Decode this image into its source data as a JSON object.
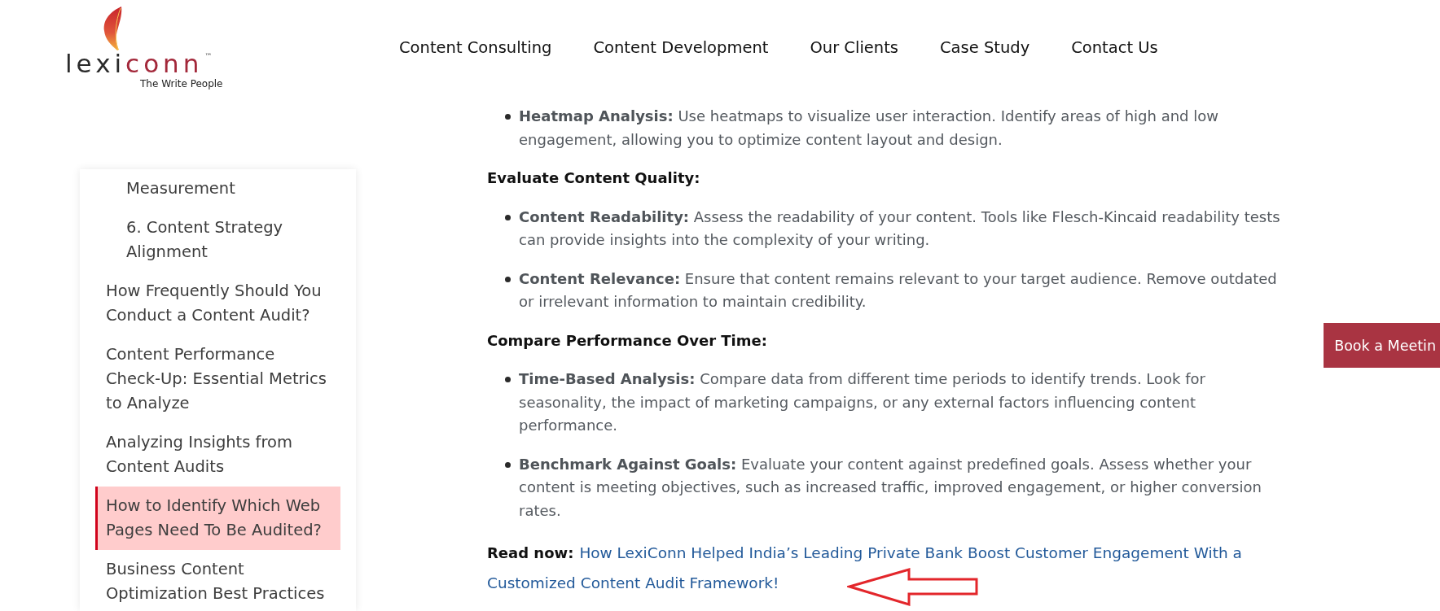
{
  "header": {
    "logo": {
      "name_dark": "lexi",
      "name_accent": "conn",
      "trademark": "™",
      "tagline": "The Write People"
    },
    "nav": [
      "Content Consulting",
      "Content Development",
      "Our Clients",
      "Case Study",
      "Contact Us"
    ]
  },
  "sidebar": {
    "items": [
      {
        "children": [
          {
            "label": "Measurement",
            "selected": false
          },
          {
            "label": "6. Content Strategy Alignment",
            "selected": false
          }
        ]
      },
      {
        "label": "How Frequently Should You Conduct a Content Audit?",
        "selected": false
      },
      {
        "label": "Content Performance Check-Up: Essential Metrics to Analyze",
        "selected": false
      },
      {
        "label": "Analyzing Insights from Content Audits",
        "selected": false
      },
      {
        "label": "How to Identify Which Web Pages Need To Be Audited?",
        "selected": true
      },
      {
        "label": "Business Content Optimization Best Practices",
        "selected": false
      }
    ]
  },
  "article": [
    {
      "kind": "bullets",
      "items": [
        "**Heatmap Analysis:** Use heatmaps to visualize user interaction. Identify areas of high and low engagement, allowing you to optimize content layout and design."
      ]
    },
    {
      "kind": "heading",
      "text": "Evaluate Content Quality:"
    },
    {
      "kind": "bullets",
      "items": [
        "**Content Readability:** Assess the readability of your content. Tools like Flesch-Kincaid readability tests can provide insights into the complexity of your writing.",
        "**Content Relevance:** Ensure that content remains relevant to your target audience. Remove outdated or irrelevant information to maintain credibility."
      ]
    },
    {
      "kind": "heading",
      "text": "Compare Performance Over Time:"
    },
    {
      "kind": "bullets",
      "items": [
        "**Time-Based Analysis:** Compare data from different time periods to identify trends. Look for seasonality, the impact of marketing campaigns, or any external factors influencing content performance.",
        "**Benchmark Against Goals:** Evaluate your content against predefined goals. Assess whether your content is meeting objectives, such as increased traffic, improved engagement, or higher conversion rates."
      ]
    },
    {
      "kind": "read_now",
      "label": "Read now:",
      "link_lines": [
        "How LexiConn Helped India’s Leading Private Bank Boost Customer Engagement With a",
        "Customized Content Audit Framework!"
      ]
    }
  ],
  "book_button": "Book a Meetin"
}
